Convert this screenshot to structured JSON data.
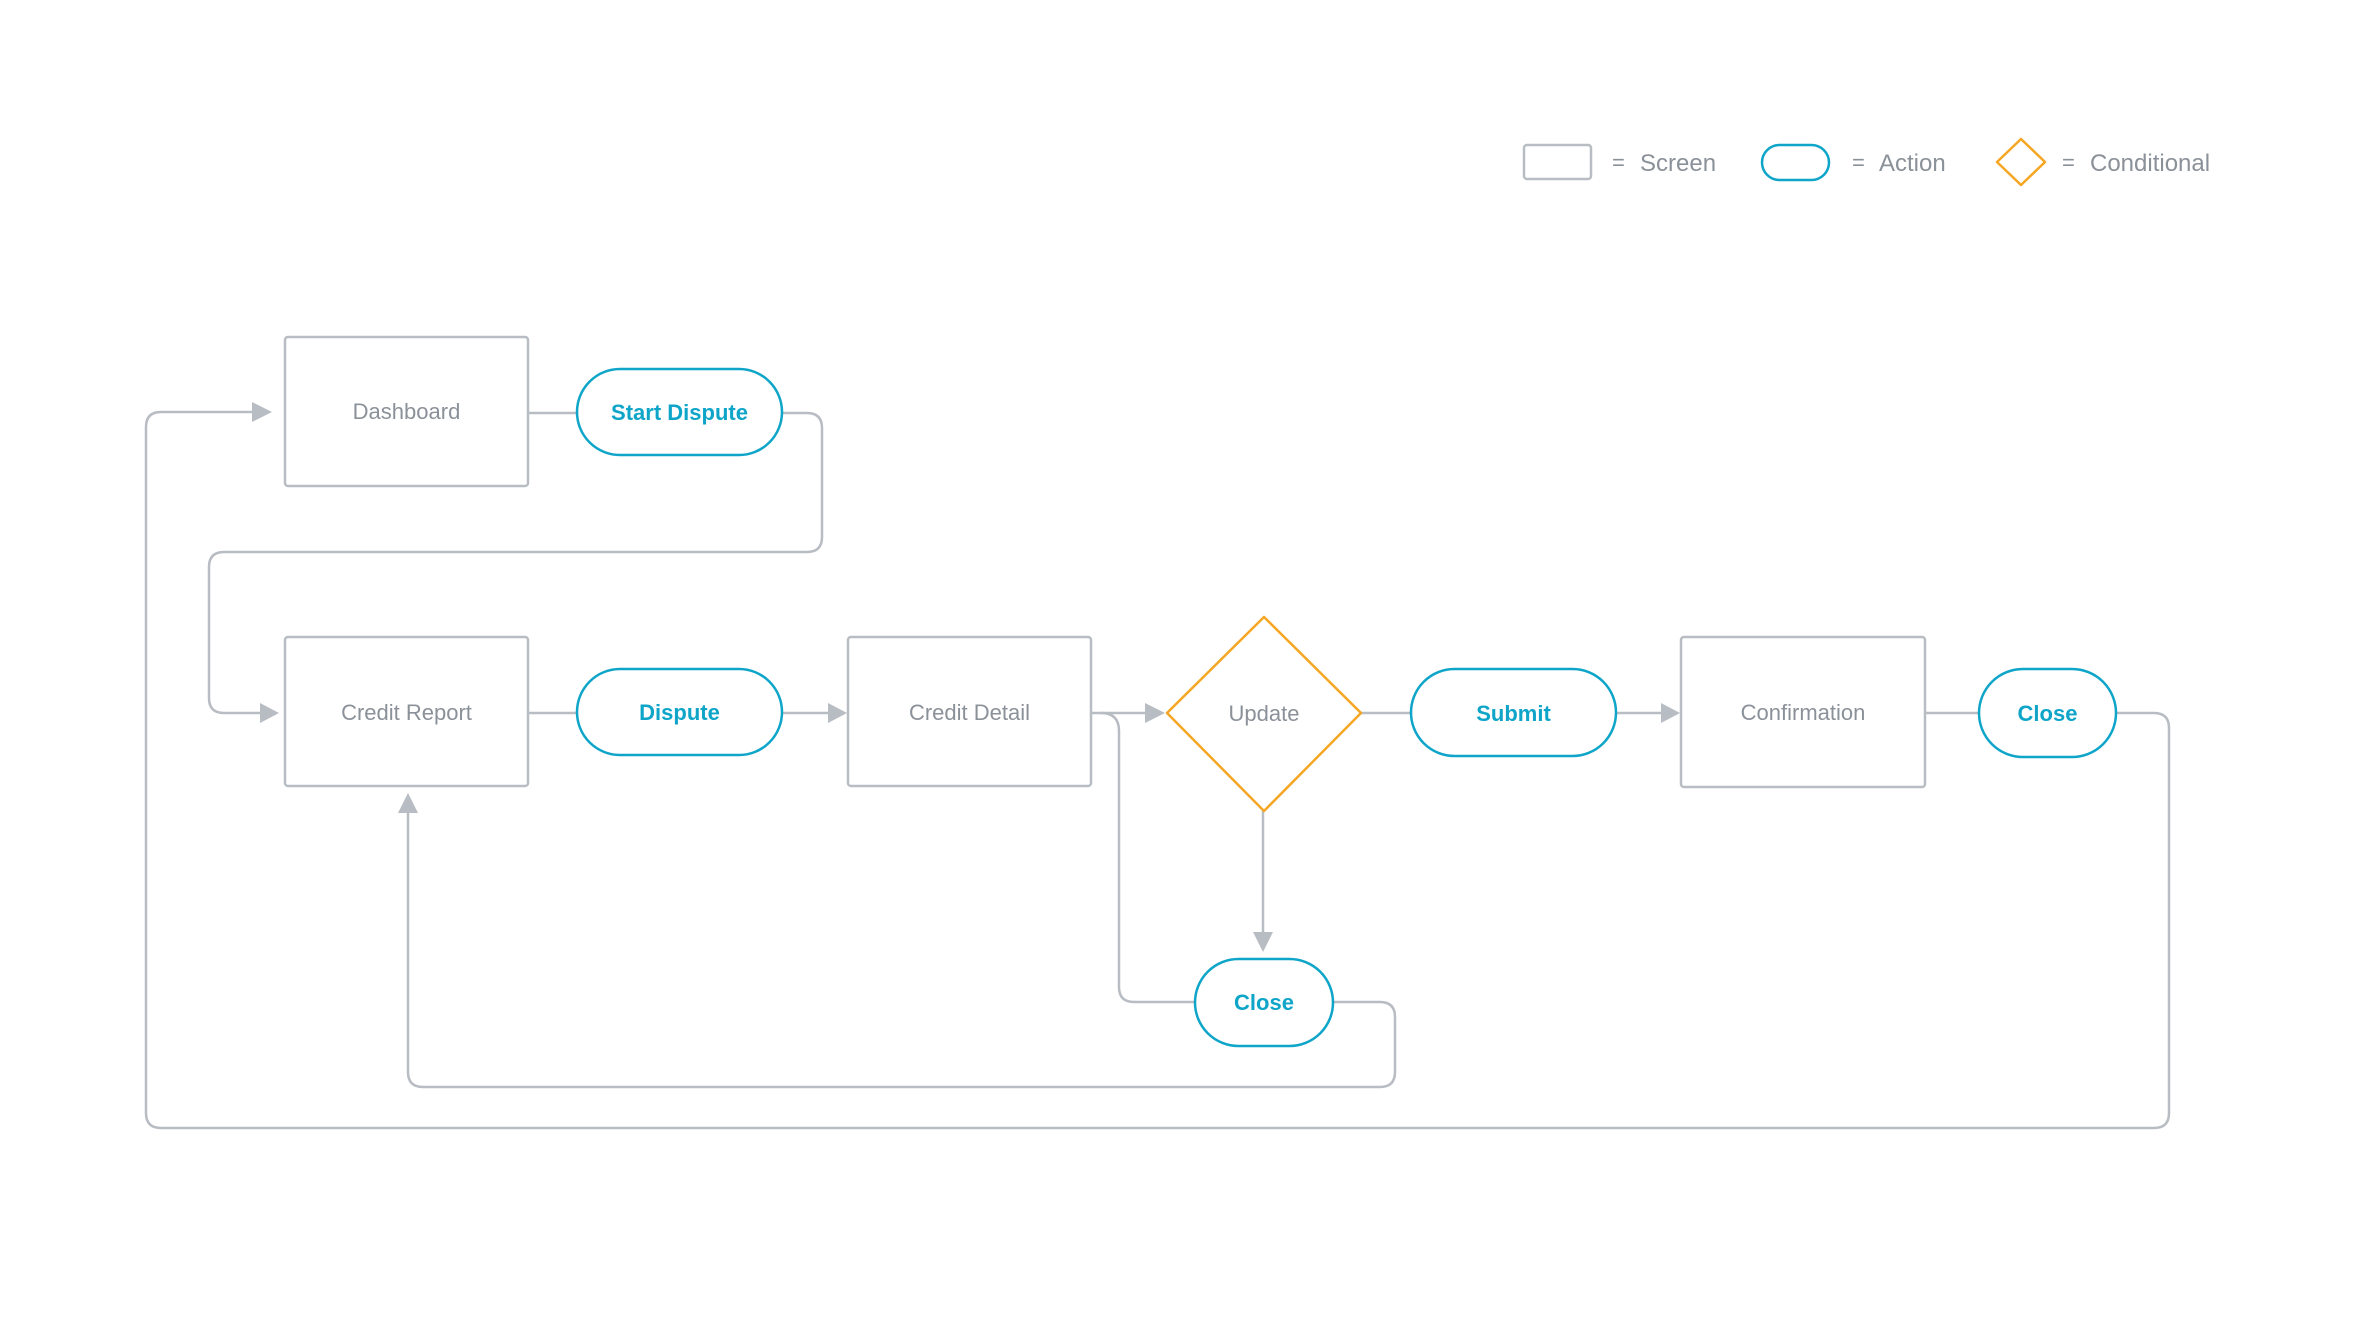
{
  "colors": {
    "screen_stroke": "#b8bcc3",
    "action_stroke": "#0ea5c9",
    "conditional_stroke": "#f5a623",
    "screen_text": "#8b9199",
    "action_text": "#0ea5c9",
    "connector": "#b8bcc3"
  },
  "legend": {
    "equals": "=",
    "items": [
      {
        "shape": "screen",
        "label": "Screen"
      },
      {
        "shape": "action",
        "label": "Action"
      },
      {
        "shape": "conditional",
        "label": "Conditional"
      }
    ]
  },
  "nodes": [
    {
      "id": "dashboard",
      "type": "screen",
      "label": "Dashboard"
    },
    {
      "id": "start-dispute",
      "type": "action",
      "label": "Start Dispute"
    },
    {
      "id": "credit-report",
      "type": "screen",
      "label": "Credit Report"
    },
    {
      "id": "dispute",
      "type": "action",
      "label": "Dispute"
    },
    {
      "id": "credit-detail",
      "type": "screen",
      "label": "Credit Detail"
    },
    {
      "id": "update",
      "type": "conditional",
      "label": "Update"
    },
    {
      "id": "submit",
      "type": "action",
      "label": "Submit"
    },
    {
      "id": "confirmation",
      "type": "screen",
      "label": "Confirmation"
    },
    {
      "id": "close-confirmation",
      "type": "action",
      "label": "Close"
    },
    {
      "id": "close-update",
      "type": "action",
      "label": "Close"
    }
  ],
  "edges": [
    {
      "from": "dashboard",
      "to": "start-dispute",
      "arrow": false
    },
    {
      "from": "start-dispute",
      "to": "credit-report",
      "arrow": true
    },
    {
      "from": "credit-report",
      "to": "dispute",
      "arrow": false
    },
    {
      "from": "dispute",
      "to": "credit-detail",
      "arrow": true
    },
    {
      "from": "credit-detail",
      "to": "update",
      "arrow": true
    },
    {
      "from": "credit-detail",
      "to": "close-update",
      "arrow": false
    },
    {
      "from": "update",
      "to": "submit",
      "arrow": false
    },
    {
      "from": "update",
      "to": "close-update",
      "arrow": true
    },
    {
      "from": "submit",
      "to": "confirmation",
      "arrow": true
    },
    {
      "from": "confirmation",
      "to": "close-confirmation",
      "arrow": false
    },
    {
      "from": "close-update",
      "to": "credit-report",
      "arrow": true
    },
    {
      "from": "close-confirmation",
      "to": "dashboard",
      "arrow": true
    }
  ]
}
